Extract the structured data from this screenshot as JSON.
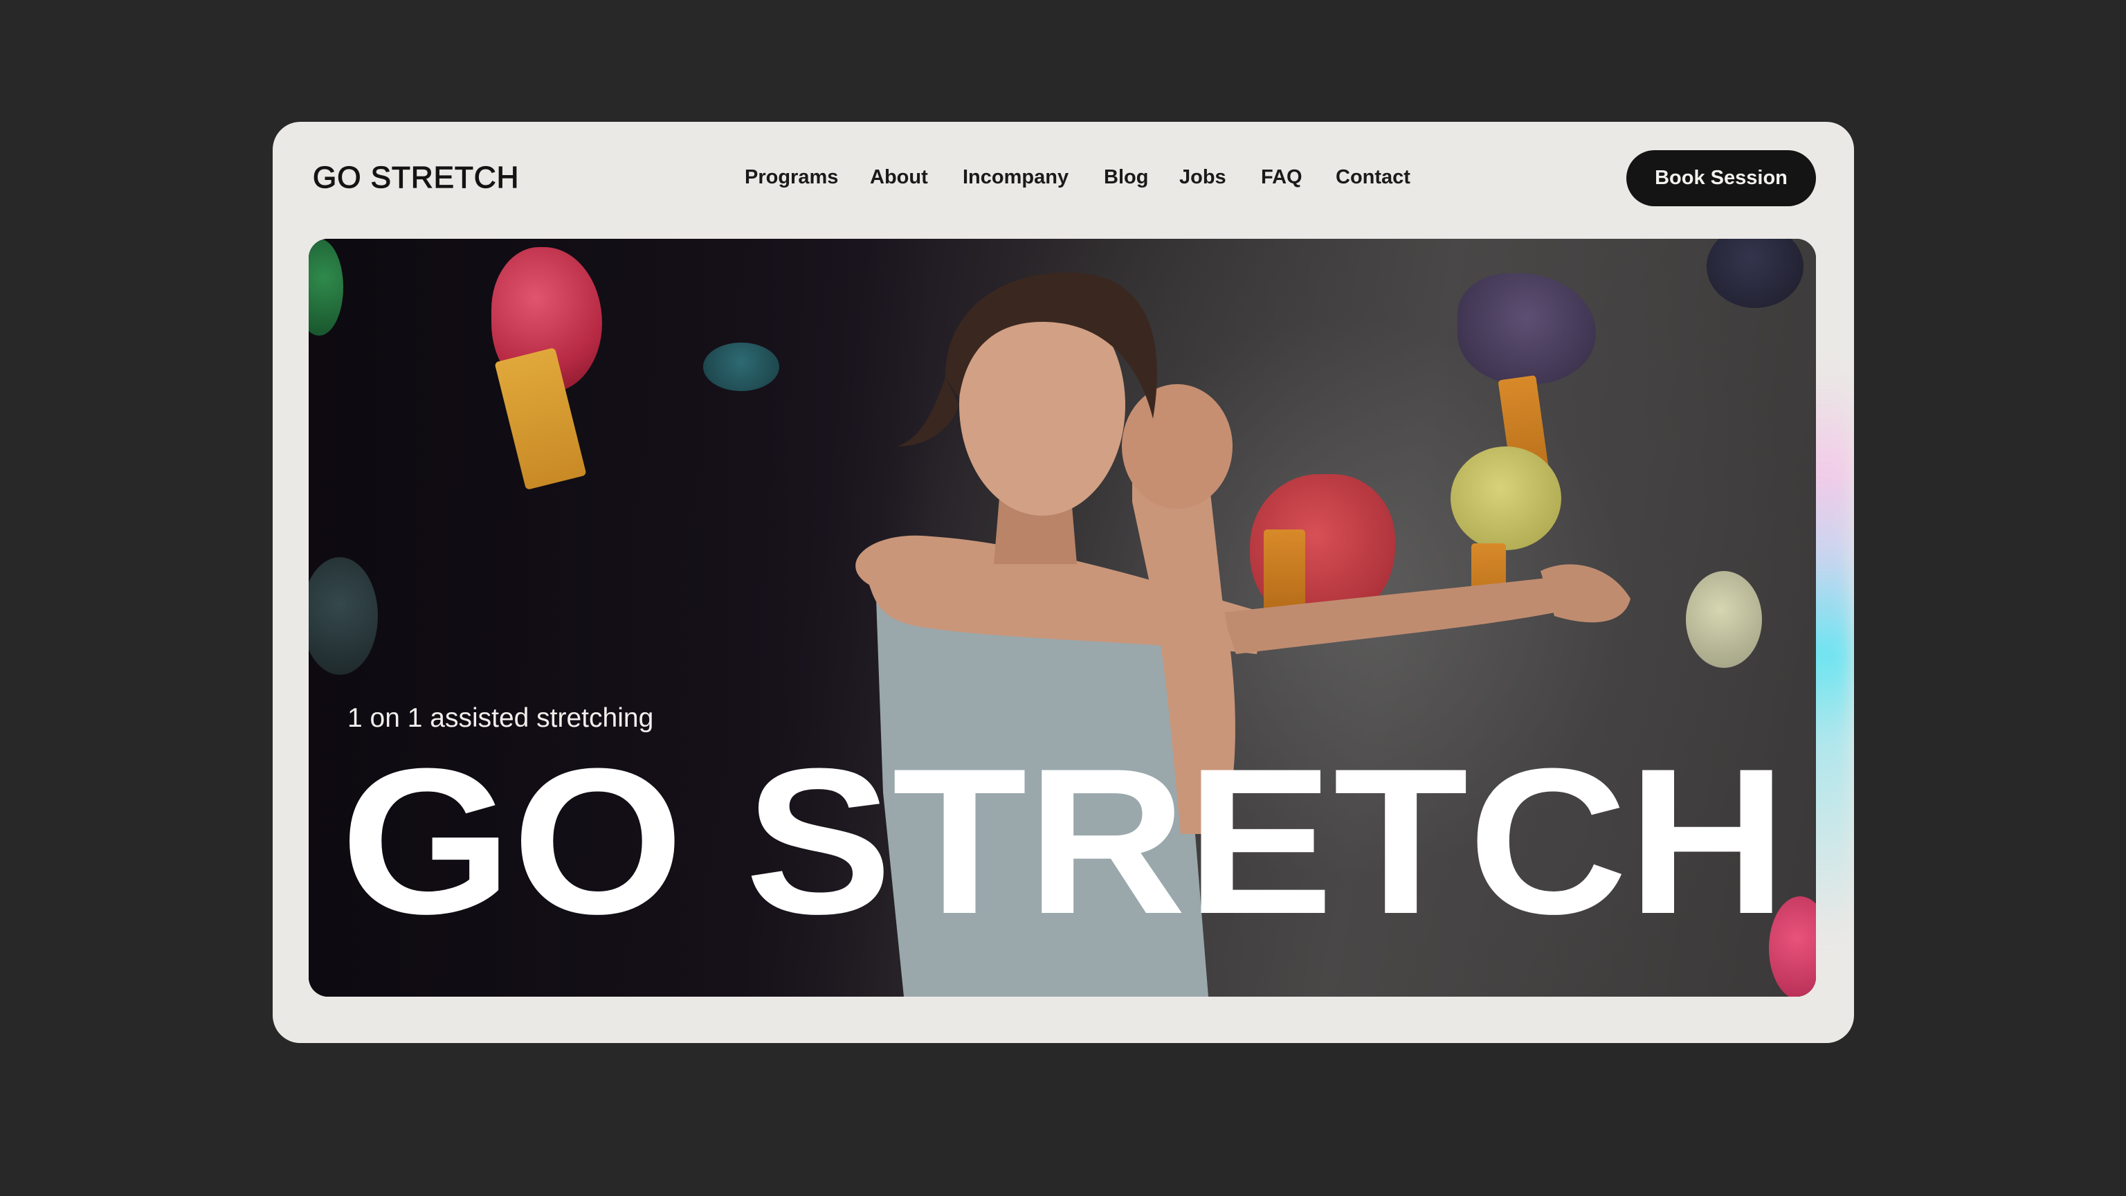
{
  "brand": {
    "logo_text": "GO STRETCH"
  },
  "nav": {
    "items": [
      {
        "label": "Programs"
      },
      {
        "label": "About"
      },
      {
        "label": "Incompany"
      },
      {
        "label": "Blog"
      },
      {
        "label": "Jobs"
      },
      {
        "label": "FAQ"
      },
      {
        "label": "Contact"
      }
    ],
    "cta_label": "Book Session"
  },
  "hero": {
    "subtitle": "1 on 1 assisted stretching",
    "title": "GO STRETCH",
    "image_subject": "woman-stretching-arm-climbing-gym-photo"
  },
  "colors": {
    "page_background": "#282828",
    "card_background": "#ebe9e6",
    "button_background": "#141414",
    "button_text": "#f4f2ef",
    "hero_text": "#ffffff"
  }
}
